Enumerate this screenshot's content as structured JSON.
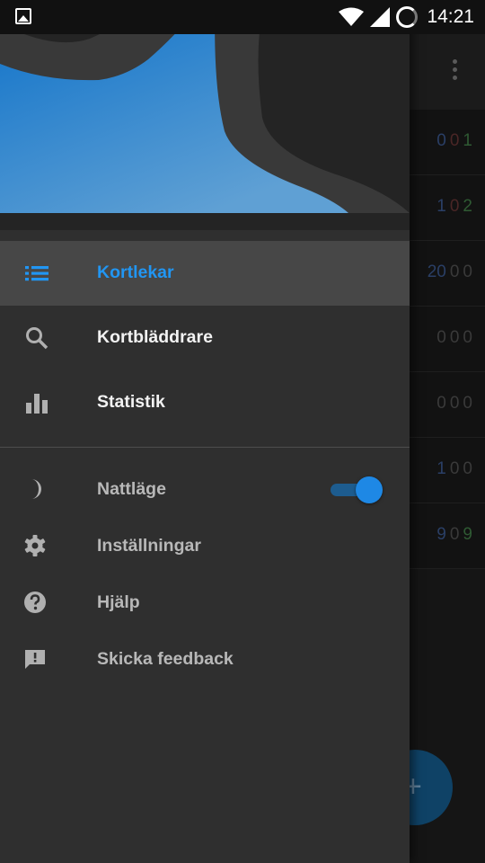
{
  "status_bar": {
    "time": "14:21",
    "icons": [
      "gallery-icon",
      "wifi-icon",
      "signal-icon",
      "battery-icon"
    ]
  },
  "background": {
    "toolbar_icon": "overflow-menu-icon",
    "rows": [
      {
        "counts": [
          {
            "value": "0",
            "tone": "blue"
          },
          {
            "value": "0",
            "tone": "red"
          },
          {
            "value": "1",
            "tone": "green"
          }
        ]
      },
      {
        "counts": [
          {
            "value": "1",
            "tone": "blue"
          },
          {
            "value": "0",
            "tone": "red"
          },
          {
            "value": "2",
            "tone": "green"
          }
        ]
      },
      {
        "counts": [
          {
            "value": "20",
            "tone": "blue"
          },
          {
            "value": "0",
            "tone": "red"
          },
          {
            "value": "0",
            "tone": "green"
          }
        ]
      },
      {
        "counts": [
          {
            "value": "0",
            "tone": "blue"
          },
          {
            "value": "0",
            "tone": "red"
          },
          {
            "value": "0",
            "tone": "green"
          }
        ]
      },
      {
        "counts": [
          {
            "value": "0",
            "tone": "blue"
          },
          {
            "value": "0",
            "tone": "red"
          },
          {
            "value": "0",
            "tone": "green"
          }
        ]
      },
      {
        "counts": [
          {
            "value": "1",
            "tone": "blue"
          },
          {
            "value": "0",
            "tone": "red"
          },
          {
            "value": "0",
            "tone": "green"
          }
        ]
      },
      {
        "counts": [
          {
            "value": "9",
            "tone": "blue"
          },
          {
            "value": "0",
            "tone": "red"
          },
          {
            "value": "9",
            "tone": "green"
          }
        ]
      }
    ],
    "fab_icon": "plus-icon",
    "fab_label": "+"
  },
  "drawer": {
    "nav": [
      {
        "label": "Kortlekar",
        "icon": "list-icon",
        "active": true
      },
      {
        "label": "Kortbläddrare",
        "icon": "search-icon",
        "active": false
      },
      {
        "label": "Statistik",
        "icon": "bar-chart-icon",
        "active": false
      }
    ],
    "options": [
      {
        "label": "Nattläge",
        "icon": "moon-icon",
        "toggle_on": true
      },
      {
        "label": "Inställningar",
        "icon": "gear-icon"
      },
      {
        "label": "Hjälp",
        "icon": "help-icon"
      },
      {
        "label": "Skicka feedback",
        "icon": "feedback-icon"
      }
    ]
  },
  "colors": {
    "accent": "#2196f3",
    "header_blue": "#1677c9",
    "drawer_bg": "#2f2f2f",
    "active_item_bg": "#474747"
  }
}
